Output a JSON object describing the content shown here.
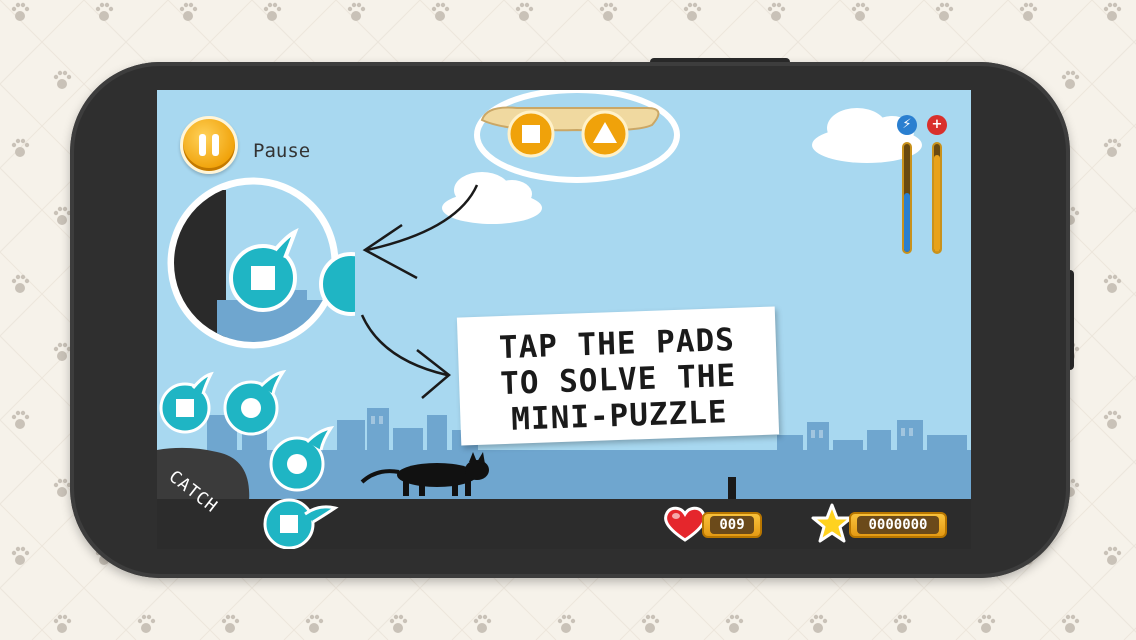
{
  "hud": {
    "pause_label": "Pause",
    "lives": "009",
    "score": "0000000",
    "catch_label": "CATCH",
    "energy_icon": "lightning-icon",
    "health_icon": "plus-icon",
    "energy_level": 0.55,
    "health_level": 0.9
  },
  "tutorial": {
    "lines": [
      "TAP THE PADS",
      "TO SOLVE THE",
      "MINI-PUZZLE"
    ]
  },
  "puzzle": {
    "symbols": [
      "square-icon",
      "triangle-icon"
    ]
  },
  "pads": [
    "square-icon",
    "circle-icon",
    "circle-icon",
    "square-icon"
  ],
  "colors": {
    "sky": "#a8d8f0",
    "city": "#6fa6cf",
    "pad": "#1fb5c4",
    "accent": "#f0a20a",
    "ground": "#2c2c2c"
  }
}
